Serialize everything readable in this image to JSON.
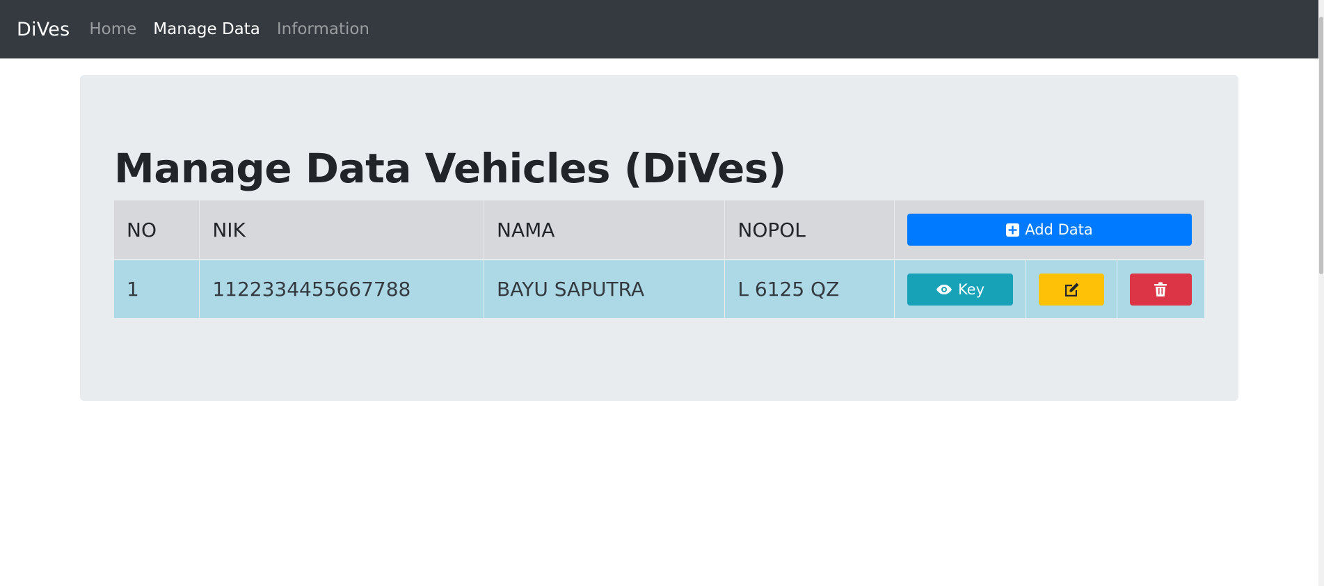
{
  "navbar": {
    "brand": "DiVes",
    "links": [
      {
        "label": "Home",
        "active": false
      },
      {
        "label": "Manage Data",
        "active": true
      },
      {
        "label": "Information",
        "active": false
      }
    ]
  },
  "main": {
    "title": "Manage Data Vehicles (DiVes)",
    "table": {
      "headers": [
        "NO",
        "NIK",
        "NAMA",
        "NOPOL"
      ],
      "add_button_label": "Add Data",
      "add_button_icon": "plus-square-icon",
      "rows": [
        {
          "no": "1",
          "nik": "1122334455667788",
          "nama": "BAYU SAPUTRA",
          "nopol": "L 6125 QZ",
          "key_label": "Key",
          "key_icon": "eye-icon",
          "edit_icon": "edit-icon",
          "delete_icon": "trash-icon"
        }
      ]
    }
  },
  "colors": {
    "navbar_bg": "#343a40",
    "jumbotron_bg": "#e9ecef",
    "table_head_bg": "#d6d8db",
    "table_row_bg": "#add8e6",
    "primary": "#007bff",
    "info": "#17a2b8",
    "warning": "#ffc107",
    "danger": "#dc3545"
  }
}
